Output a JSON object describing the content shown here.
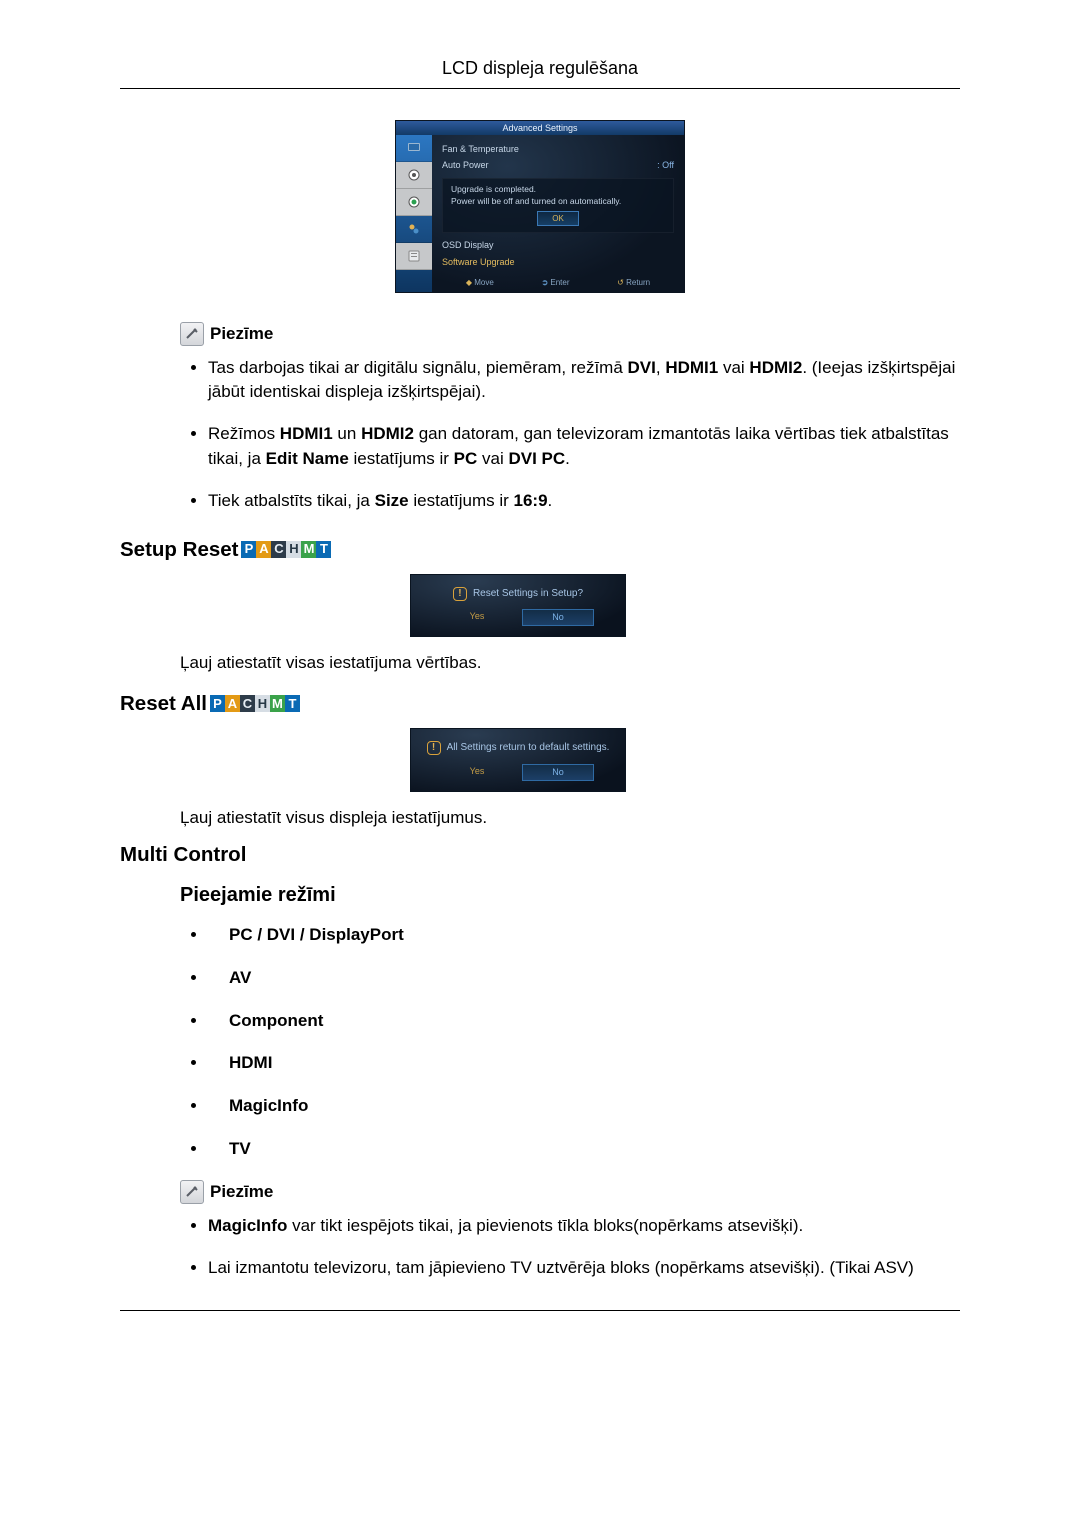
{
  "header": {
    "title": "LCD displeja regulēšana"
  },
  "osd": {
    "title": "Advanced Settings",
    "rows": {
      "fan": "Fan & Temperature",
      "auto_power_l": "Auto Power",
      "auto_power_r": ": Off",
      "osd_display": "OSD Display",
      "software_upgrade": "Software Upgrade"
    },
    "modal": {
      "line1": "Upgrade is completed.",
      "line2": "Power will be off and turned on automatically.",
      "ok": "OK"
    },
    "footer": {
      "move": "Move",
      "enter": "Enter",
      "return": "Return"
    }
  },
  "note1": {
    "label": "Piezīme",
    "b1_pre": "Tas darbojas tikai ar digitālu signālu, piemēram, režīmā ",
    "b1_b1": "DVI",
    "b1_mid1": ", ",
    "b1_b2": "HDMI1",
    "b1_mid2": " vai ",
    "b1_b3": "HDMI2",
    "b1_post": ". (Ieejas izšķirtspējai jābūt identiskai displeja izšķirtspējai).",
    "b2_pre": "Režīmos ",
    "b2_b1": "HDMI1",
    "b2_mid1": " un ",
    "b2_b2": "HDMI2",
    "b2_mid2": " gan datoram, gan televizoram izmantotās laika vērtības tiek atbalstītas tikai, ja ",
    "b2_b3": "Edit Name",
    "b2_mid3": " iestatījums ir ",
    "b2_b4": "PC",
    "b2_mid4": " vai ",
    "b2_b5": "DVI PC",
    "b2_post": ".",
    "b3_pre": "Tiek atbalstīts tikai, ja ",
    "b3_b1": "Size",
    "b3_mid": " iestatījums ir ",
    "b3_b2": "16:9",
    "b3_post": "."
  },
  "setup_reset": {
    "heading": "Setup Reset",
    "question": "Reset Settings in Setup?",
    "yes": "Yes",
    "no": "No",
    "desc": "Ļauj atiestatīt visas iestatījuma vērtības."
  },
  "reset_all": {
    "heading": "Reset All",
    "question": "All Settings return to default settings.",
    "yes": "Yes",
    "no": "No",
    "desc": "Ļauj atiestatīt visus displeja iestatījumus."
  },
  "multi_control": {
    "heading": "Multi Control",
    "sub_heading": "Pieejamie režīmi",
    "modes": {
      "p": "PC / DVI / DisplayPort",
      "a": "AV",
      "c": "Component",
      "h": "HDMI",
      "m": "MagicInfo",
      "t": "TV"
    }
  },
  "note2": {
    "label": "Piezīme",
    "b1_b": "MagicInfo",
    "b1_post": " var tikt iespējots tikai, ja pievienots tīkla bloks(nopērkams atsevišķi).",
    "b2": "Lai izmantotu televizoru, tam jāpievieno TV uztvērēja bloks (nopērkams atsevišķi). (Tikai ASV)"
  },
  "badges": {
    "p": "P",
    "a": "A",
    "c": "C",
    "h": "H",
    "m": "M",
    "t": "T"
  }
}
